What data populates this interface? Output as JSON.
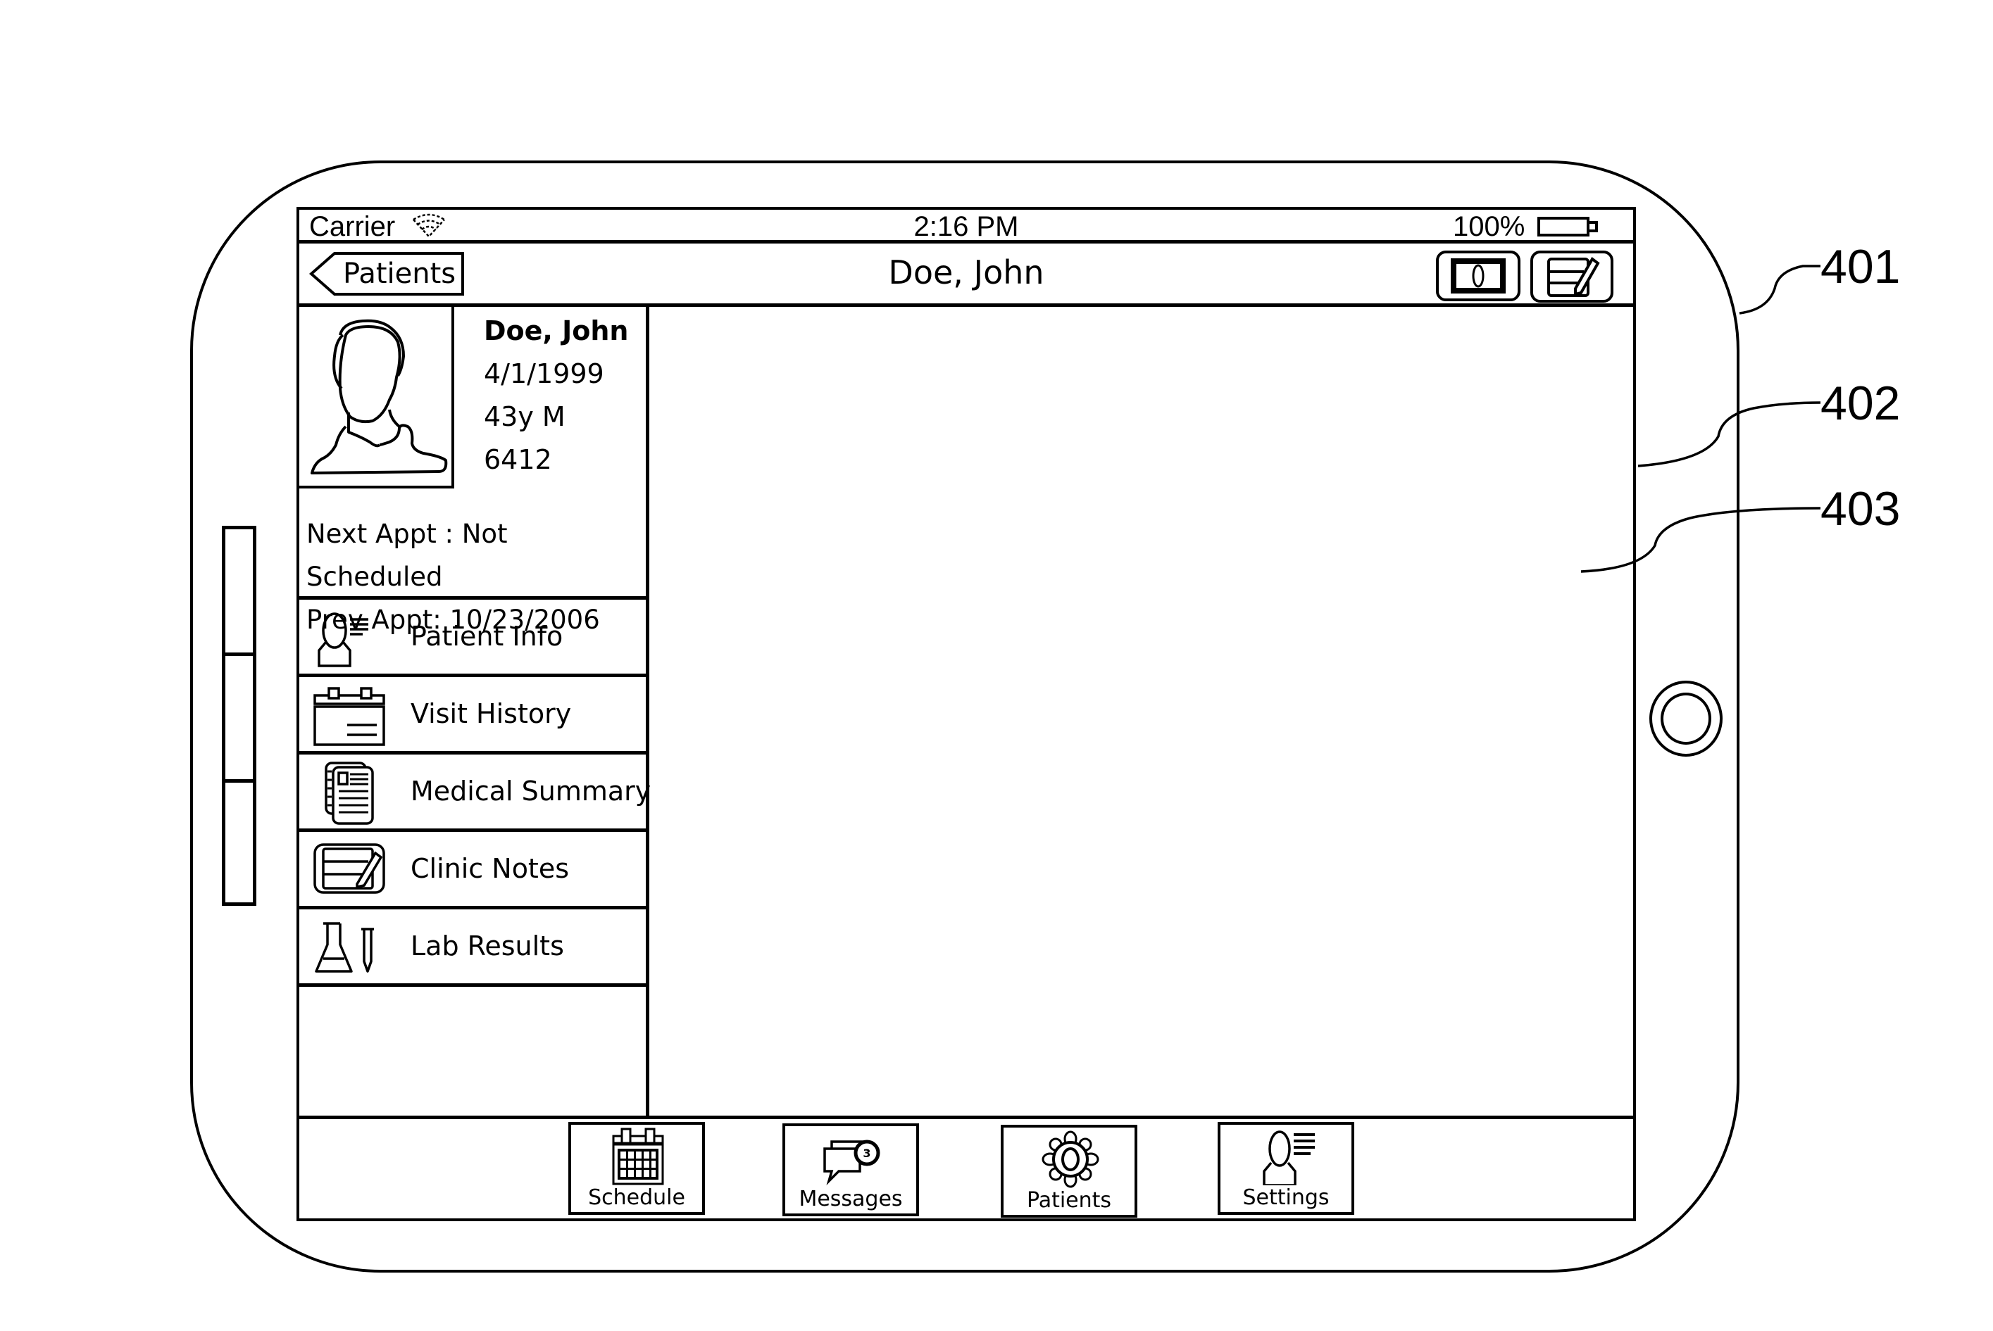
{
  "status_bar": {
    "carrier": "Carrier",
    "wifi_icon": "wifi-icon",
    "time": "2:16 PM",
    "battery_percent": "100%",
    "battery_icon": "battery-icon"
  },
  "nav_bar": {
    "back_label": "Patients",
    "title": "Doe, John",
    "actions": [
      {
        "name": "photo-button",
        "icon": "photo-icon"
      },
      {
        "name": "edit-button",
        "icon": "edit-note-icon"
      }
    ]
  },
  "patient": {
    "name": "Doe, John",
    "dob": "4/1/1999",
    "age_sex": "43y M",
    "id": "6412",
    "avatar_icon": "person-silhouette-icon",
    "next_appt": "Next Appt : Not Scheduled",
    "prev_appt": "Prev Appt: 10/23/2006"
  },
  "menu": {
    "items": [
      {
        "label": "Patient Info",
        "icon": "patient-info-icon"
      },
      {
        "label": "Visit History",
        "icon": "calendar-list-icon"
      },
      {
        "label": "Medical Summary",
        "icon": "documents-icon"
      },
      {
        "label": "Clinic Notes",
        "icon": "notepad-pencil-icon"
      },
      {
        "label": "Lab Results",
        "icon": "flask-test-tube-icon"
      }
    ]
  },
  "tab_bar": {
    "tabs": [
      {
        "label": "Schedule",
        "icon": "calendar-icon"
      },
      {
        "label": "Messages",
        "icon": "chat-bubbles-icon",
        "badge": "3"
      },
      {
        "label": "Patients",
        "icon": "gear-icon"
      },
      {
        "label": "Settings",
        "icon": "person-list-icon"
      }
    ]
  },
  "reference_labels": {
    "device": "401",
    "screen": "402",
    "content_pane": "403"
  }
}
